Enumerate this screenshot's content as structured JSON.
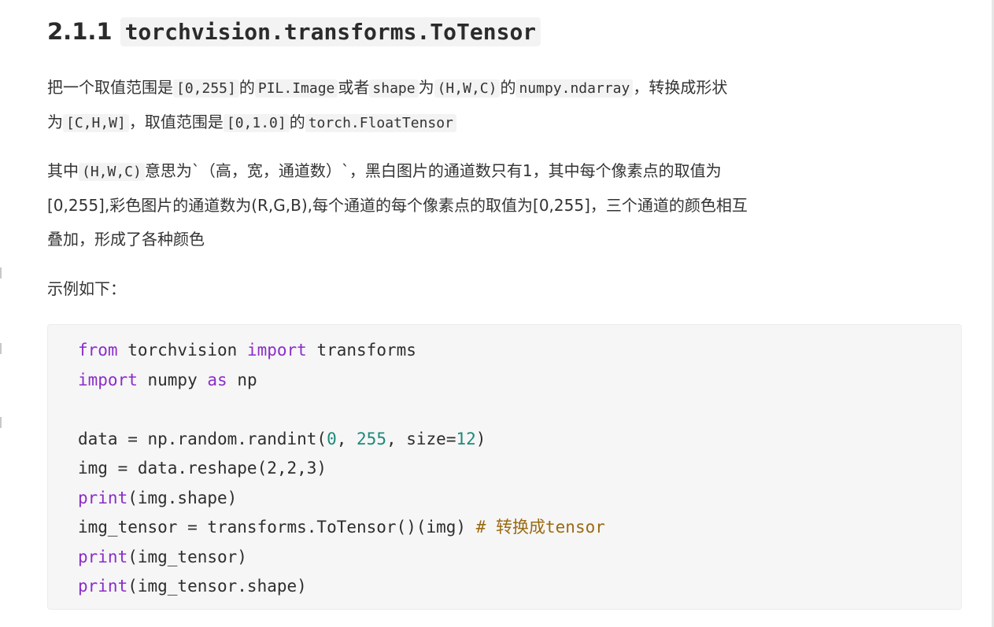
{
  "heading": {
    "number": "2.1.1",
    "code": "torchvision.transforms.ToTensor"
  },
  "paragraph1": {
    "line1": {
      "t1": "把一个取值范围是",
      "c1": "[0,255]",
      "t2": "的",
      "c2": "PIL.Image",
      "t3": "或者",
      "c3": "shape",
      "t4": "为",
      "c4": "(H,W,C)",
      "t5": "的",
      "c5": "numpy.ndarray",
      "t6": "，转换成形状"
    },
    "line2": {
      "t1": "为",
      "c1": "[C,H,W]",
      "t2": "，取值范围是",
      "c2": "[0,1.0]",
      "t3": "的",
      "c3": "torch.FloatTensor"
    }
  },
  "paragraph2": {
    "line1": {
      "t1": "其中",
      "c1": "(H,W,C)",
      "t2": "意思为`（高，宽，通道数）`，黑白图片的通道数只有1，其中每个像素点的取值为"
    },
    "line2": "[0,255],彩色图片的通道数为(R,G,B),每个通道的每个像素点的取值为[0,255]，三个通道的颜色相互",
    "line3": "叠加，形成了各种颜色"
  },
  "paragraph3": "示例如下：",
  "code": {
    "l1": {
      "k1": "from",
      "a": " torchvision ",
      "k2": "import",
      "b": " transforms"
    },
    "l2": {
      "k1": "import",
      "a": " numpy ",
      "k2": "as",
      "b": " np"
    },
    "l4": {
      "a": "data = np.random.randint(",
      "n1": "0",
      "b": ", ",
      "n2": "255",
      "c": ", size=",
      "n3": "12",
      "d": ")"
    },
    "l5": "img = data.reshape(2,2,3)",
    "l6": {
      "k": "print",
      "a": "(img.shape)"
    },
    "l7": {
      "a": "img_tensor = transforms.ToTensor()(img) ",
      "cm": "# 转换成tensor"
    },
    "l8": {
      "k": "print",
      "a": "(img_tensor)"
    },
    "l9": {
      "k": "print",
      "a": "(img_tensor.shape)"
    }
  },
  "colors": {
    "keyword": "#8b2dc9",
    "number": "#1b8a7a",
    "comment": "#9a6a12",
    "code_background": "#f6f6f6"
  }
}
